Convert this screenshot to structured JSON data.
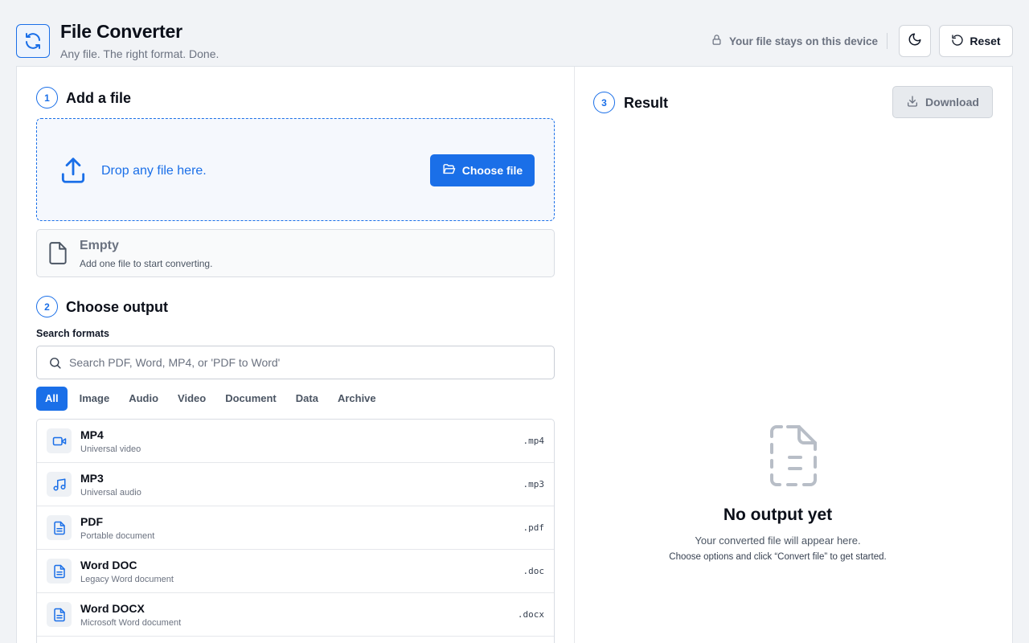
{
  "header": {
    "title": "File Converter",
    "subtitle": "Any file. The right format. Done.",
    "privacy_text": "Your file stays on this device",
    "reset_label": "Reset"
  },
  "colors": {
    "accent": "#1a6fe8",
    "background": "#f1f3f6"
  },
  "step1": {
    "number": "1",
    "title": "Add a file",
    "drop_text": "Drop any file here.",
    "choose_label": "Choose file",
    "empty_title": "Empty",
    "empty_sub": "Add one file to start converting."
  },
  "step2": {
    "number": "2",
    "title": "Choose output",
    "search_label": "Search formats",
    "search_placeholder": "Search PDF, Word, MP4, or 'PDF to Word'",
    "tabs": [
      "All",
      "Image",
      "Audio",
      "Video",
      "Document",
      "Data",
      "Archive"
    ],
    "formats": [
      {
        "name": "MP4",
        "desc": "Universal video",
        "ext": ".mp4",
        "icon": "video-icon"
      },
      {
        "name": "MP3",
        "desc": "Universal audio",
        "ext": ".mp3",
        "icon": "music-icon"
      },
      {
        "name": "PDF",
        "desc": "Portable document",
        "ext": ".pdf",
        "icon": "document-icon"
      },
      {
        "name": "Word DOC",
        "desc": "Legacy Word document",
        "ext": ".doc",
        "icon": "document-icon"
      },
      {
        "name": "Word DOCX",
        "desc": "Microsoft Word document",
        "ext": ".docx",
        "icon": "document-icon"
      }
    ]
  },
  "step3": {
    "number": "3",
    "title": "Result",
    "download_label": "Download",
    "no_output_title": "No output yet",
    "no_output_sub1": "Your converted file will appear here.",
    "no_output_sub2": "Choose options and click “Convert file” to get started."
  }
}
